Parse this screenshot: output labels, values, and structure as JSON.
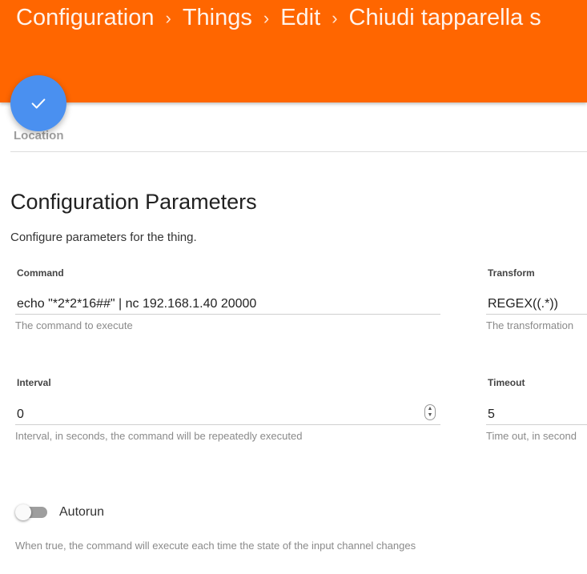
{
  "breadcrumb": {
    "items": [
      "Configuration",
      "Things",
      "Edit",
      "Chiudi tapparella s"
    ],
    "separator": "›"
  },
  "fab": {
    "icon": "check-icon"
  },
  "location": {
    "label": "Location"
  },
  "section": {
    "title": "Configuration Parameters",
    "description": "Configure parameters for the thing."
  },
  "fields": {
    "command": {
      "label": "Command",
      "value": "echo \"*2*2*16##\" | nc 192.168.1.40 20000",
      "help": "The command to execute"
    },
    "transform": {
      "label": "Transform",
      "value": "REGEX((.*))",
      "help": "The transformation"
    },
    "interval": {
      "label": "Interval",
      "value": "0",
      "help": "Interval, in seconds, the command will be repeatedly executed"
    },
    "timeout": {
      "label": "Timeout",
      "value": "5",
      "help": "Time out, in second"
    }
  },
  "autorun": {
    "label": "Autorun",
    "enabled": false,
    "help": "When true, the command will execute each time the state of the input channel changes"
  },
  "colors": {
    "header": "#ff6600",
    "fab": "#4a90f0"
  }
}
